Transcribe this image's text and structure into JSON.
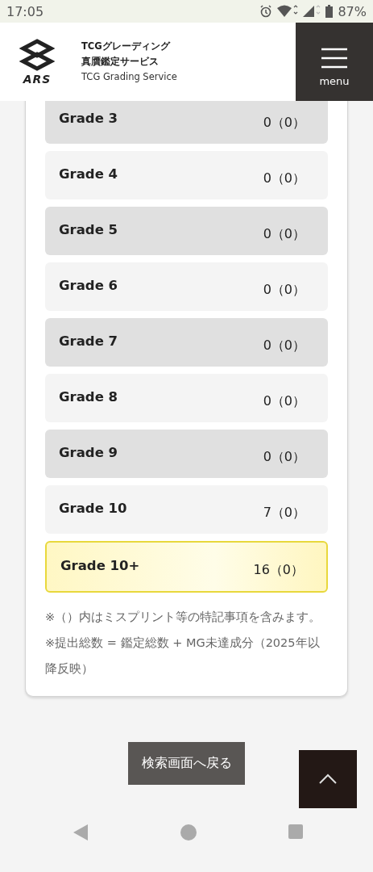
{
  "status_bar": {
    "time": "17:05",
    "battery": "87%"
  },
  "header": {
    "logo_text": "ARS",
    "title_lines": [
      "TCGグレーディング",
      "真贋鑑定サービス"
    ],
    "subtitle": "TCG Grading Service",
    "menu_label": "menu"
  },
  "grades": [
    {
      "label": "Grade 3",
      "value": "0（0）",
      "kind": "shaded"
    },
    {
      "label": "Grade 4",
      "value": "0（0）",
      "kind": "plain"
    },
    {
      "label": "Grade 5",
      "value": "0（0）",
      "kind": "shaded"
    },
    {
      "label": "Grade 6",
      "value": "0（0）",
      "kind": "plain"
    },
    {
      "label": "Grade 7",
      "value": "0（0）",
      "kind": "shaded"
    },
    {
      "label": "Grade 8",
      "value": "0（0）",
      "kind": "plain"
    },
    {
      "label": "Grade 9",
      "value": "0（0）",
      "kind": "shaded"
    },
    {
      "label": "Grade 10",
      "value": "7（0）",
      "kind": "plain"
    },
    {
      "label": "Grade 10+",
      "value": "16（0）",
      "kind": "highlight"
    }
  ],
  "notes": [
    "※（）内はミスプリント等の特記事項を含みます。",
    "※提出総数 = 鑑定総数 + MG未達成分（2025年以降反映）"
  ],
  "back_button": "検索画面へ戻る"
}
